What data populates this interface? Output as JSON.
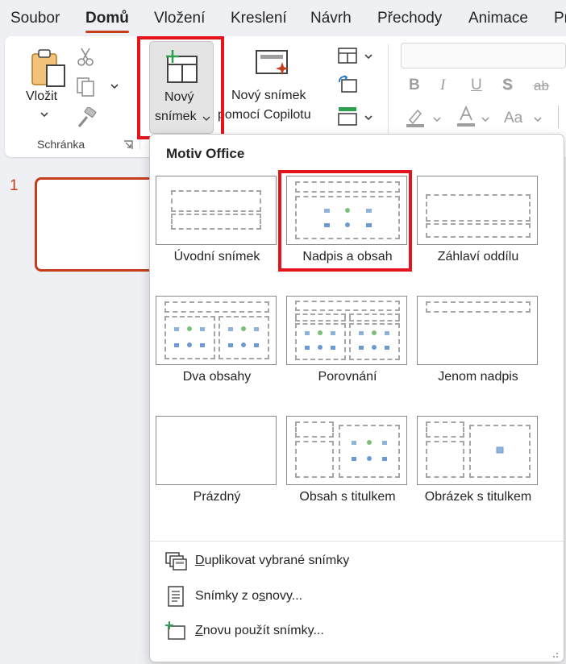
{
  "menu": {
    "tabs": [
      "Soubor",
      "Domů",
      "Vložení",
      "Kreslení",
      "Návrh",
      "Přechody",
      "Animace",
      "Pr"
    ],
    "active_index": 1
  },
  "ribbon": {
    "paste_label": "Vložit",
    "clipboard_group_label": "Schránka",
    "new_slide_line1": "Nový",
    "new_slide_line2": "snímek",
    "copilot_line1": "Nový snímek",
    "copilot_line2": "pomocí Copilotu",
    "font_size_control": "Aa",
    "accent_color": "#c43e1c",
    "highlight_color": "#e3141b"
  },
  "slides": {
    "current_number": "1"
  },
  "dropdown": {
    "header": "Motiv Office",
    "layouts": [
      {
        "key": "title",
        "label": "Úvodní snímek"
      },
      {
        "key": "title-content",
        "label": "Nadpis a obsah"
      },
      {
        "key": "section-header",
        "label": "Záhlaví oddílu"
      },
      {
        "key": "two-content",
        "label": "Dva obsahy"
      },
      {
        "key": "comparison",
        "label": "Porovnání"
      },
      {
        "key": "title-only",
        "label": "Jenom nadpis"
      },
      {
        "key": "blank",
        "label": "Prázdný"
      },
      {
        "key": "content-caption",
        "label": "Obsah s titulkem"
      },
      {
        "key": "picture-caption",
        "label": "Obrázek s titulkem"
      }
    ],
    "actions": {
      "duplicate": {
        "accel": "D",
        "rest": "uplikovat vybrané snímky"
      },
      "outline": {
        "pre": "Snímky z o",
        "accel": "s",
        "rest": "novy..."
      },
      "reuse": {
        "accel": "Z",
        "rest": "novu použít snímky..."
      }
    }
  }
}
